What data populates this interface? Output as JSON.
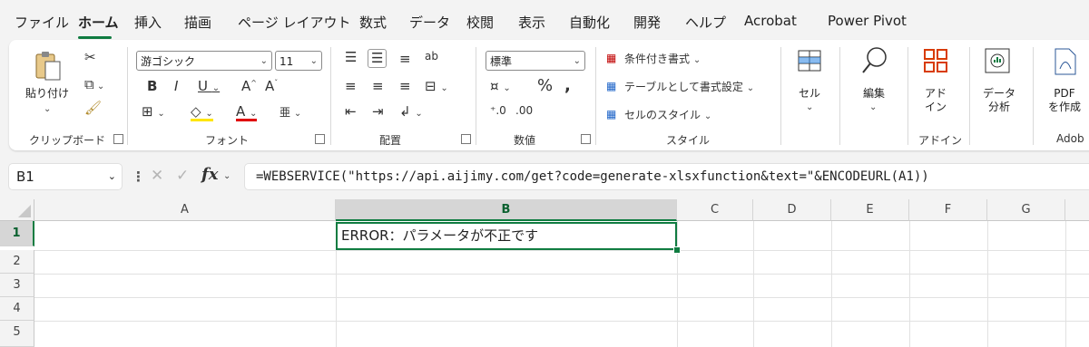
{
  "menu": {
    "tabs": [
      "ファイル",
      "ホーム",
      "挿入",
      "描画",
      "ページ レイアウト",
      "数式",
      "データ",
      "校閲",
      "表示",
      "自動化",
      "開発",
      "ヘルプ",
      "Acrobat",
      "Power Pivot"
    ],
    "active": "ホーム"
  },
  "ribbon": {
    "clipboard": {
      "paste_label": "貼り付け",
      "group_label": "クリップボード"
    },
    "font": {
      "font_name": "游ゴシック",
      "font_size": "11",
      "group_label": "フォント"
    },
    "alignment": {
      "group_label": "配置"
    },
    "number": {
      "format": "標準",
      "group_label": "数値"
    },
    "styles": {
      "conditional": "条件付き書式",
      "table": "テーブルとして書式設定",
      "cell_styles": "セルのスタイル",
      "group_label": "スタイル"
    },
    "cells": {
      "label": "セル"
    },
    "editing": {
      "label": "編集"
    },
    "addins": {
      "label": "アド\nイン",
      "group_label": "アドイン"
    },
    "analysis": {
      "label": "データ\n分析"
    },
    "pdf": {
      "label": "PDF\nを作成",
      "group_label": "Adob"
    }
  },
  "formula_bar": {
    "name_box": "B1",
    "fx": "fx",
    "formula": "=WEBSERVICE(\"https://api.aijimy.com/get?code=generate-xlsxfunction&text=\"&ENCODEURL(A1))"
  },
  "sheet": {
    "columns": [
      "A",
      "B",
      "C",
      "D",
      "E",
      "F",
      "G"
    ],
    "rows": [
      "1",
      "2",
      "3",
      "4",
      "5"
    ],
    "selected_cell": "B1",
    "cells": {
      "B1": "ERROR：パラメータが不正です"
    }
  },
  "colors": {
    "accent": "#107c41"
  }
}
